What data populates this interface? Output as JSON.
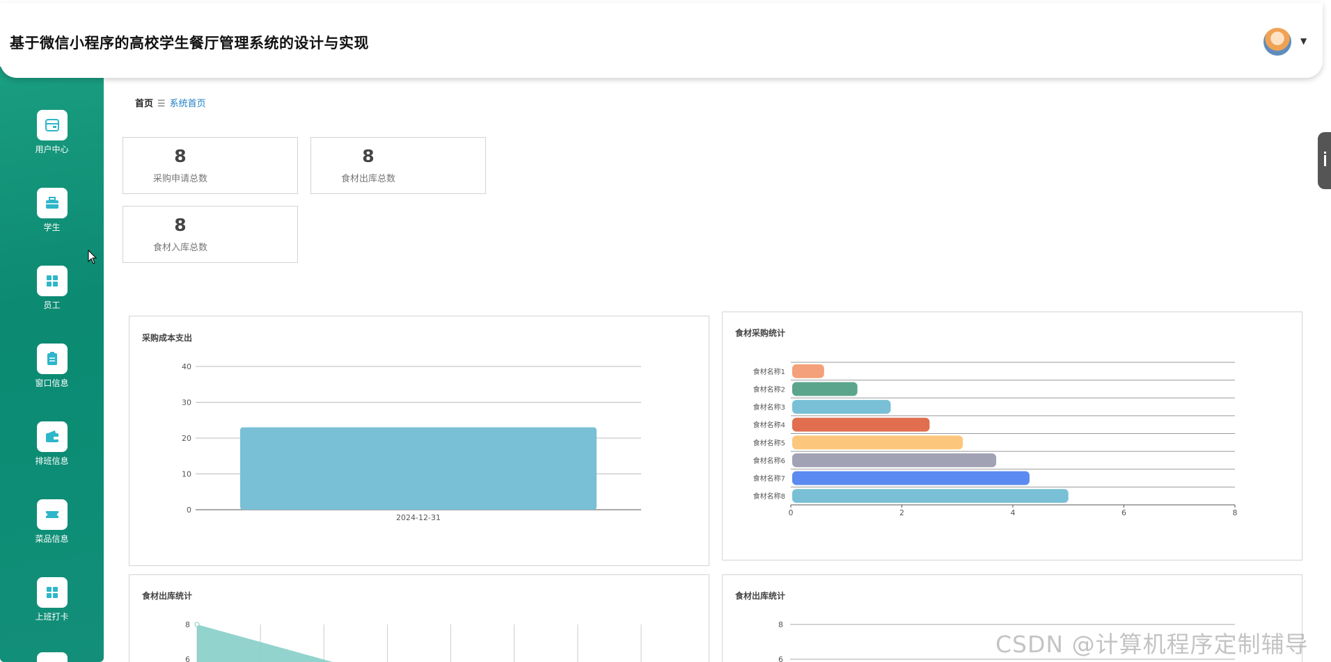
{
  "header": {
    "title": "基于微信小程序的高校学生餐厅管理系统的设计与实现",
    "avatar": "avatar-image",
    "caret": "▼"
  },
  "sidebar": {
    "items": [
      {
        "label": "用户中心",
        "icon": "wallet-icon"
      },
      {
        "label": "学生",
        "icon": "briefcase-icon"
      },
      {
        "label": "员工",
        "icon": "grid-icon"
      },
      {
        "label": "窗口信息",
        "icon": "clipboard-icon"
      },
      {
        "label": "排班信息",
        "icon": "wallet-icon"
      },
      {
        "label": "菜品信息",
        "icon": "ticket-icon"
      },
      {
        "label": "上班打卡",
        "icon": "grid-icon"
      }
    ]
  },
  "breadcrumb": {
    "home": "首页",
    "separator": "☰",
    "current": "系统首页"
  },
  "stats": [
    {
      "value": "8",
      "label": "采购申请总数"
    },
    {
      "value": "8",
      "label": "食材出库总数"
    },
    {
      "value": "8",
      "label": "食材入库总数"
    }
  ],
  "colors": {
    "sidebar": "#0f8c74",
    "accent": "#1e7fc4",
    "bar": "#79c0d6"
  },
  "panels": {
    "cost": {
      "title": "采购成本支出"
    },
    "purchase": {
      "title": "食材采购统计"
    },
    "outbound": {
      "title": "食材出库统计"
    },
    "outbound2": {
      "title": "食材出库统计"
    }
  },
  "chart_data": [
    {
      "type": "bar",
      "title": "采购成本支出",
      "categories": [
        "2024-12-31"
      ],
      "values": [
        23
      ],
      "ylim": [
        0,
        40
      ],
      "yticks": [
        0,
        10,
        20,
        30,
        40
      ],
      "grid": true
    },
    {
      "type": "bar",
      "orientation": "horizontal",
      "title": "食材采购统计",
      "categories": [
        "食材名称1",
        "食材名称2",
        "食材名称3",
        "食材名称4",
        "食材名称5",
        "食材名称6",
        "食材名称7",
        "食材名称8"
      ],
      "values": [
        0.6,
        1.2,
        1.8,
        2.5,
        3.1,
        3.7,
        4.3,
        5.0
      ],
      "colors": [
        "#f4a07a",
        "#5ba58c",
        "#79c0d6",
        "#e06e4f",
        "#fcc77c",
        "#a2a2b5",
        "#5b8af0",
        "#79c0d6"
      ],
      "xlim": [
        0,
        8
      ],
      "xticks": [
        0,
        2,
        4,
        6,
        8
      ],
      "grid": true
    },
    {
      "type": "area",
      "title": "食材出库统计",
      "visible_yticks": [
        8,
        6
      ],
      "values_partial": [
        8,
        6
      ],
      "color": "#7fcdc4"
    },
    {
      "type": "bar",
      "title": "食材出库统计",
      "visible_yticks": [
        8,
        6
      ]
    }
  ],
  "watermark": "CSDN @计算机程序定制辅导"
}
